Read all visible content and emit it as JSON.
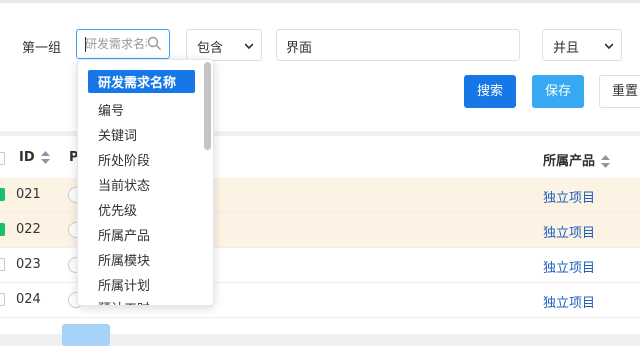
{
  "filter": {
    "group_label": "第一组",
    "field_placeholder": "研发需求名称",
    "operator_value": "包含",
    "value_text": "界面",
    "logic_value": "并且",
    "search_label": "搜索",
    "save_label": "保存",
    "reset_label": "重置"
  },
  "dropdown": {
    "items": [
      "研发需求名称",
      "编号",
      "关键词",
      "所处阶段",
      "当前状态",
      "优先级",
      "所属产品",
      "所属模块",
      "所属计划",
      "预计工时"
    ]
  },
  "table": {
    "headers": {
      "id": "ID",
      "p": "P",
      "product": "所属产品"
    },
    "rows": [
      {
        "id": "021",
        "product": "独立项目",
        "checked": true,
        "highlight": true
      },
      {
        "id": "022",
        "product": "独立项目",
        "checked": true,
        "highlight": true
      },
      {
        "id": "023",
        "product": "独立项目",
        "checked": false,
        "highlight": false
      },
      {
        "id": "024",
        "product": "独立项目",
        "checked": false,
        "highlight": false
      }
    ]
  },
  "colors": {
    "primary": "#1677e6",
    "accent": "#37a9f2",
    "link": "#1f5fbf",
    "row_highlight": "#fdf3e4",
    "check_on": "#15c26b"
  }
}
